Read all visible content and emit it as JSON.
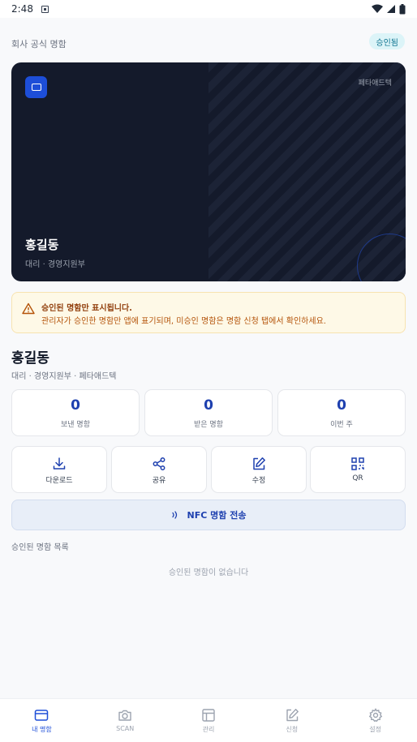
{
  "status_bar": {
    "time": "2:48"
  },
  "header": {
    "company_label": "회사 공식 명함",
    "badge": "승인됨"
  },
  "card": {
    "company": "페타애드텍",
    "name": "홍길동",
    "title": "대리 · 경영지원부"
  },
  "notice": {
    "title": "승인된 명함만 표시됩니다.",
    "body": "관리자가 승인한 명함만 앱에 표기되며, 미승인 명함은 명함 신청 탭에서 확인하세요."
  },
  "profile": {
    "name": "홍길동",
    "subtitle": "대리 · 경영지원부 · 페타애드텍"
  },
  "stats": [
    {
      "value": "0",
      "label": "보낸 명함"
    },
    {
      "value": "0",
      "label": "받은 명함"
    },
    {
      "value": "0",
      "label": "이번 주"
    }
  ],
  "actions": [
    {
      "label": "다운로드",
      "icon": "download-icon"
    },
    {
      "label": "공유",
      "icon": "share-icon"
    },
    {
      "label": "수정",
      "icon": "edit-icon"
    },
    {
      "label": "QR",
      "icon": "qr-icon"
    }
  ],
  "nfc": {
    "label": "NFC 명함 전송"
  },
  "list": {
    "header": "승인된 명함 목록",
    "empty": "승인된 명함이 없습니다"
  },
  "nav": [
    {
      "label": "내 명함",
      "icon": "card-icon",
      "active": true
    },
    {
      "label": "SCAN",
      "icon": "camera-icon",
      "active": false
    },
    {
      "label": "관리",
      "icon": "manage-icon",
      "active": false
    },
    {
      "label": "신청",
      "icon": "apply-icon",
      "active": false
    },
    {
      "label": "설정",
      "icon": "settings-icon",
      "active": false
    }
  ],
  "colors": {
    "accent": "#1e40af",
    "card_bg": "#141a2b",
    "notice_bg": "#fef9e7",
    "badge_bg": "#dcf4f8"
  }
}
